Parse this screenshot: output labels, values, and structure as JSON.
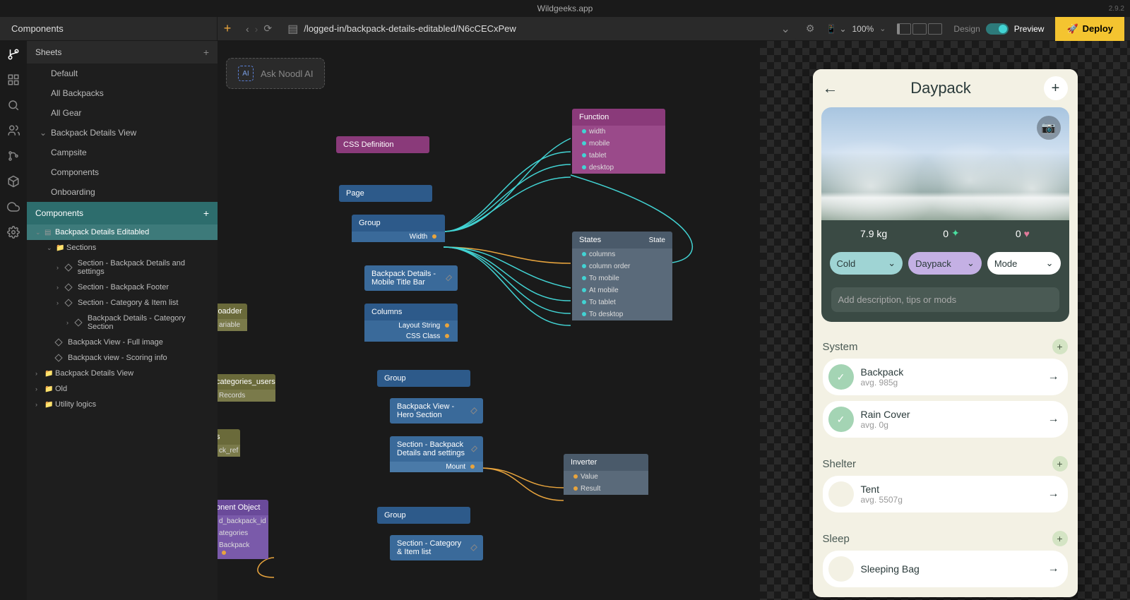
{
  "app": {
    "title": "Wildgeeks.app",
    "version": "2.9.2"
  },
  "toolbar": {
    "panel_title": "Components",
    "url": "/logged-in/backpack-details-editabled/N6cCECxPew",
    "zoom": "100%",
    "design_label": "Design",
    "preview_label": "Preview",
    "deploy_label": "Deploy"
  },
  "sidebar": {
    "sheets_label": "Sheets",
    "sheets": [
      "Default",
      "All Backpacks",
      "All Gear",
      "Backpack Details View",
      "Campsite",
      "Components",
      "Onboarding"
    ],
    "sheets_expanded_index": 3,
    "components_label": "Components",
    "tree": {
      "root": "Backpack Details Editabled",
      "sections_label": "Sections",
      "items": [
        "Section - Backpack Details and settings",
        "Section - Backpack Footer",
        "Section - Category & Item list",
        "Backpack Details - Category Section",
        "Backpack View - Full image",
        "Backpack view - Scoring info"
      ],
      "others": [
        "Backpack Details View",
        "Old",
        "Utility logics"
      ]
    }
  },
  "canvas": {
    "ai_placeholder": "Ask Noodl AI",
    "nodes": {
      "css": "CSS Definition",
      "page": "Page",
      "group1": "Group",
      "group1_port": "Width",
      "titlebar": "Backpack Details - Mobile Title Bar",
      "columns": "Columns",
      "columns_p1": "Layout String",
      "columns_p2": "CSS Class",
      "group2": "Group",
      "hero": "Backpack View - Hero Section",
      "details": "Section - Backpack Details and settings",
      "details_port": "Mount",
      "group3": "Group",
      "catlist": "Section - Category & Item list",
      "function": "Function",
      "func_ports": [
        "width",
        "mobile",
        "tablet",
        "desktop"
      ],
      "states": "States",
      "states_right": "State",
      "states_ports": [
        "columns",
        "column order",
        "To mobile",
        "At mobile",
        "To tablet",
        "To desktop"
      ],
      "inverter": "Inverter",
      "inverter_ports": [
        "Value",
        "Result"
      ],
      "loader": "loadder",
      "loader2": "ariable",
      "catusers": "categories_users",
      "catusers2": "Records",
      "compobj": "onent Object",
      "compobj_ports": [
        "d_backpack_id",
        "ategories",
        "Backpack"
      ],
      "misc1": "s",
      "misc2": "ck_ref"
    }
  },
  "preview": {
    "title": "Daypack",
    "weight": "7.9 kg",
    "score1": "0",
    "score2": "0",
    "chips": [
      "Cold",
      "Daypack",
      "Mode"
    ],
    "desc_placeholder": "Add description, tips or mods",
    "sections": [
      {
        "title": "System",
        "items": [
          {
            "name": "Backpack",
            "sub": "avg. 985g",
            "checked": true
          },
          {
            "name": "Rain Cover",
            "sub": "avg. 0g",
            "checked": true
          }
        ]
      },
      {
        "title": "Shelter",
        "items": [
          {
            "name": "Tent",
            "sub": "avg. 5507g",
            "checked": false
          }
        ]
      },
      {
        "title": "Sleep",
        "items": [
          {
            "name": "Sleeping Bag",
            "sub": "",
            "checked": false
          }
        ]
      }
    ]
  }
}
